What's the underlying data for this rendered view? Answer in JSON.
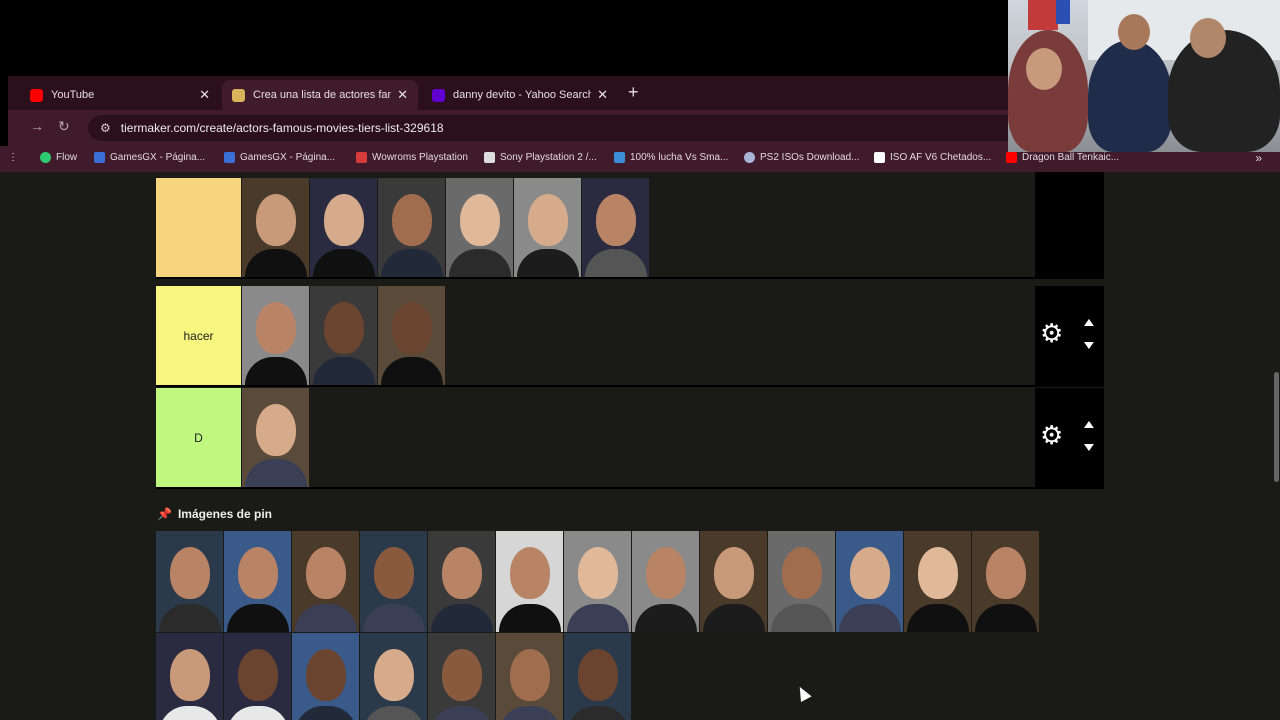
{
  "browser": {
    "tabs": [
      {
        "title": "YouTube",
        "favicon": "youtube-icon",
        "color": "#ff0000",
        "active": false
      },
      {
        "title": "Crea una lista de actores famos",
        "favicon": "tiermaker-icon",
        "color": "#d9b45a",
        "active": true
      },
      {
        "title": "danny devito - Yahoo Search T",
        "favicon": "yahoo-icon",
        "color": "#6001d2",
        "active": false
      }
    ],
    "url": "tiermaker.com/create/actors-famous-movies-tiers-list-329618",
    "bookmarks": [
      {
        "label": "Flow",
        "color": "#2ecc71"
      },
      {
        "label": "GamesGX - Página...",
        "color": "#3b6fd8"
      },
      {
        "label": "GamesGX - Página...",
        "color": "#3b6fd8"
      },
      {
        "label": "Wowroms Playstation",
        "color": "#d83b3b"
      },
      {
        "label": "Sony Playstation 2 /...",
        "color": "#dddddd"
      },
      {
        "label": "100% lucha Vs Sma...",
        "color": "#3b8fd8"
      },
      {
        "label": "PS2 ISOs Download...",
        "color": "#aab4d8"
      },
      {
        "label": "ISO AF V6 Chetados...",
        "color": "#ffffff"
      },
      {
        "label": "Dragon Ball Tenkaic...",
        "color": "#ff0000"
      }
    ]
  },
  "tiers": [
    {
      "label": "",
      "color": "#f7d57f",
      "count": 6
    },
    {
      "label": "hacer",
      "color": "#f7f77f",
      "count": 3
    },
    {
      "label": "D",
      "color": "#bff77f",
      "count": 1
    }
  ],
  "pool": {
    "title": "Imágenes de pin",
    "count": 20
  }
}
